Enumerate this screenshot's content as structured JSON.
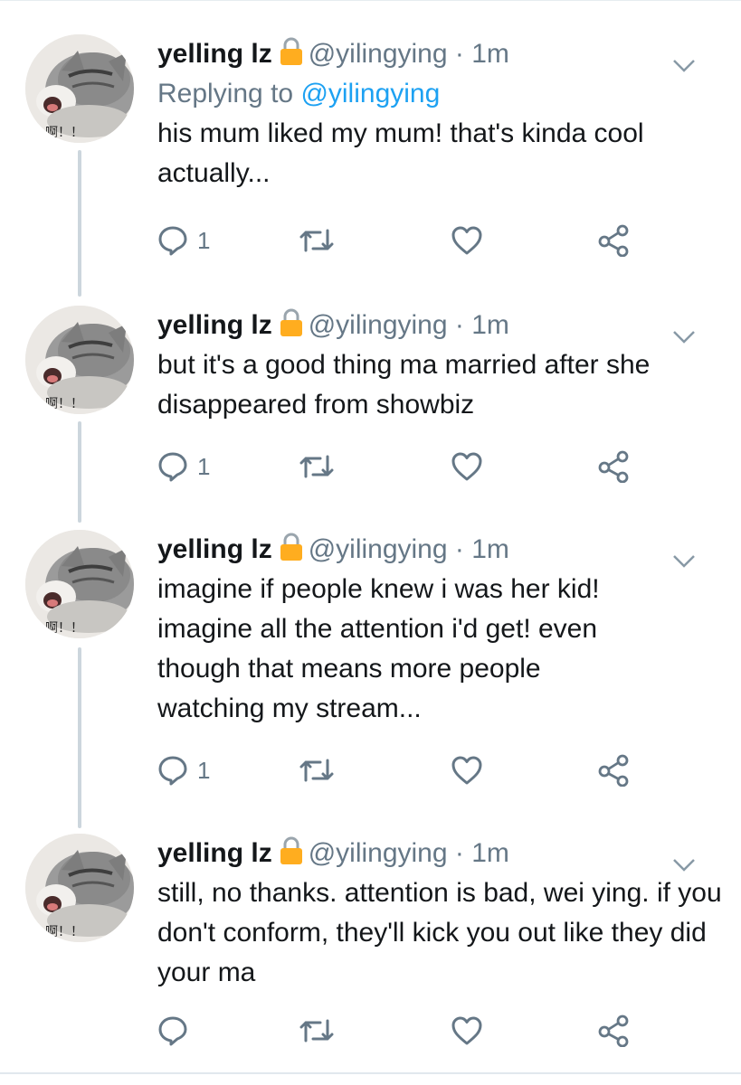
{
  "tweets": [
    {
      "name": "yelling lz",
      "handle": "@yilingying",
      "time": "· 1m",
      "reply_prefix": "Replying to ",
      "reply_handle": "@yilingying",
      "text": "his mum liked my mum! that's kinda cool actually...",
      "reply_count": "1",
      "avatar_caption": "啊！！"
    },
    {
      "name": "yelling lz",
      "handle": "@yilingying",
      "time": "· 1m",
      "text": "but it's a good thing ma married after she disappeared from showbiz",
      "reply_count": "1",
      "avatar_caption": "啊！！"
    },
    {
      "name": "yelling lz",
      "handle": "@yilingying",
      "time": "· 1m",
      "text": "imagine if people knew i was her kid! imagine all the attention i'd get! even though that means more people watching my stream...",
      "reply_count": "1",
      "avatar_caption": "啊！！"
    },
    {
      "name": "yelling lz",
      "handle": "@yilingying",
      "time": "· 1m",
      "text": "still, no thanks. attention is bad, wei ying. if you don't conform, they'll kick you out like they did your ma",
      "reply_count": "",
      "avatar_caption": "啊！！"
    }
  ],
  "icons": {
    "lock": "lock-icon",
    "more": "chevron-down-icon",
    "reply": "reply-icon",
    "retweet": "retweet-icon",
    "like": "heart-icon",
    "share": "share-icon"
  },
  "colors": {
    "text": "#14171a",
    "secondary": "#657786",
    "link": "#1da1f2",
    "lock": "#ffad1f",
    "thread_line": "#ccd6dd"
  }
}
